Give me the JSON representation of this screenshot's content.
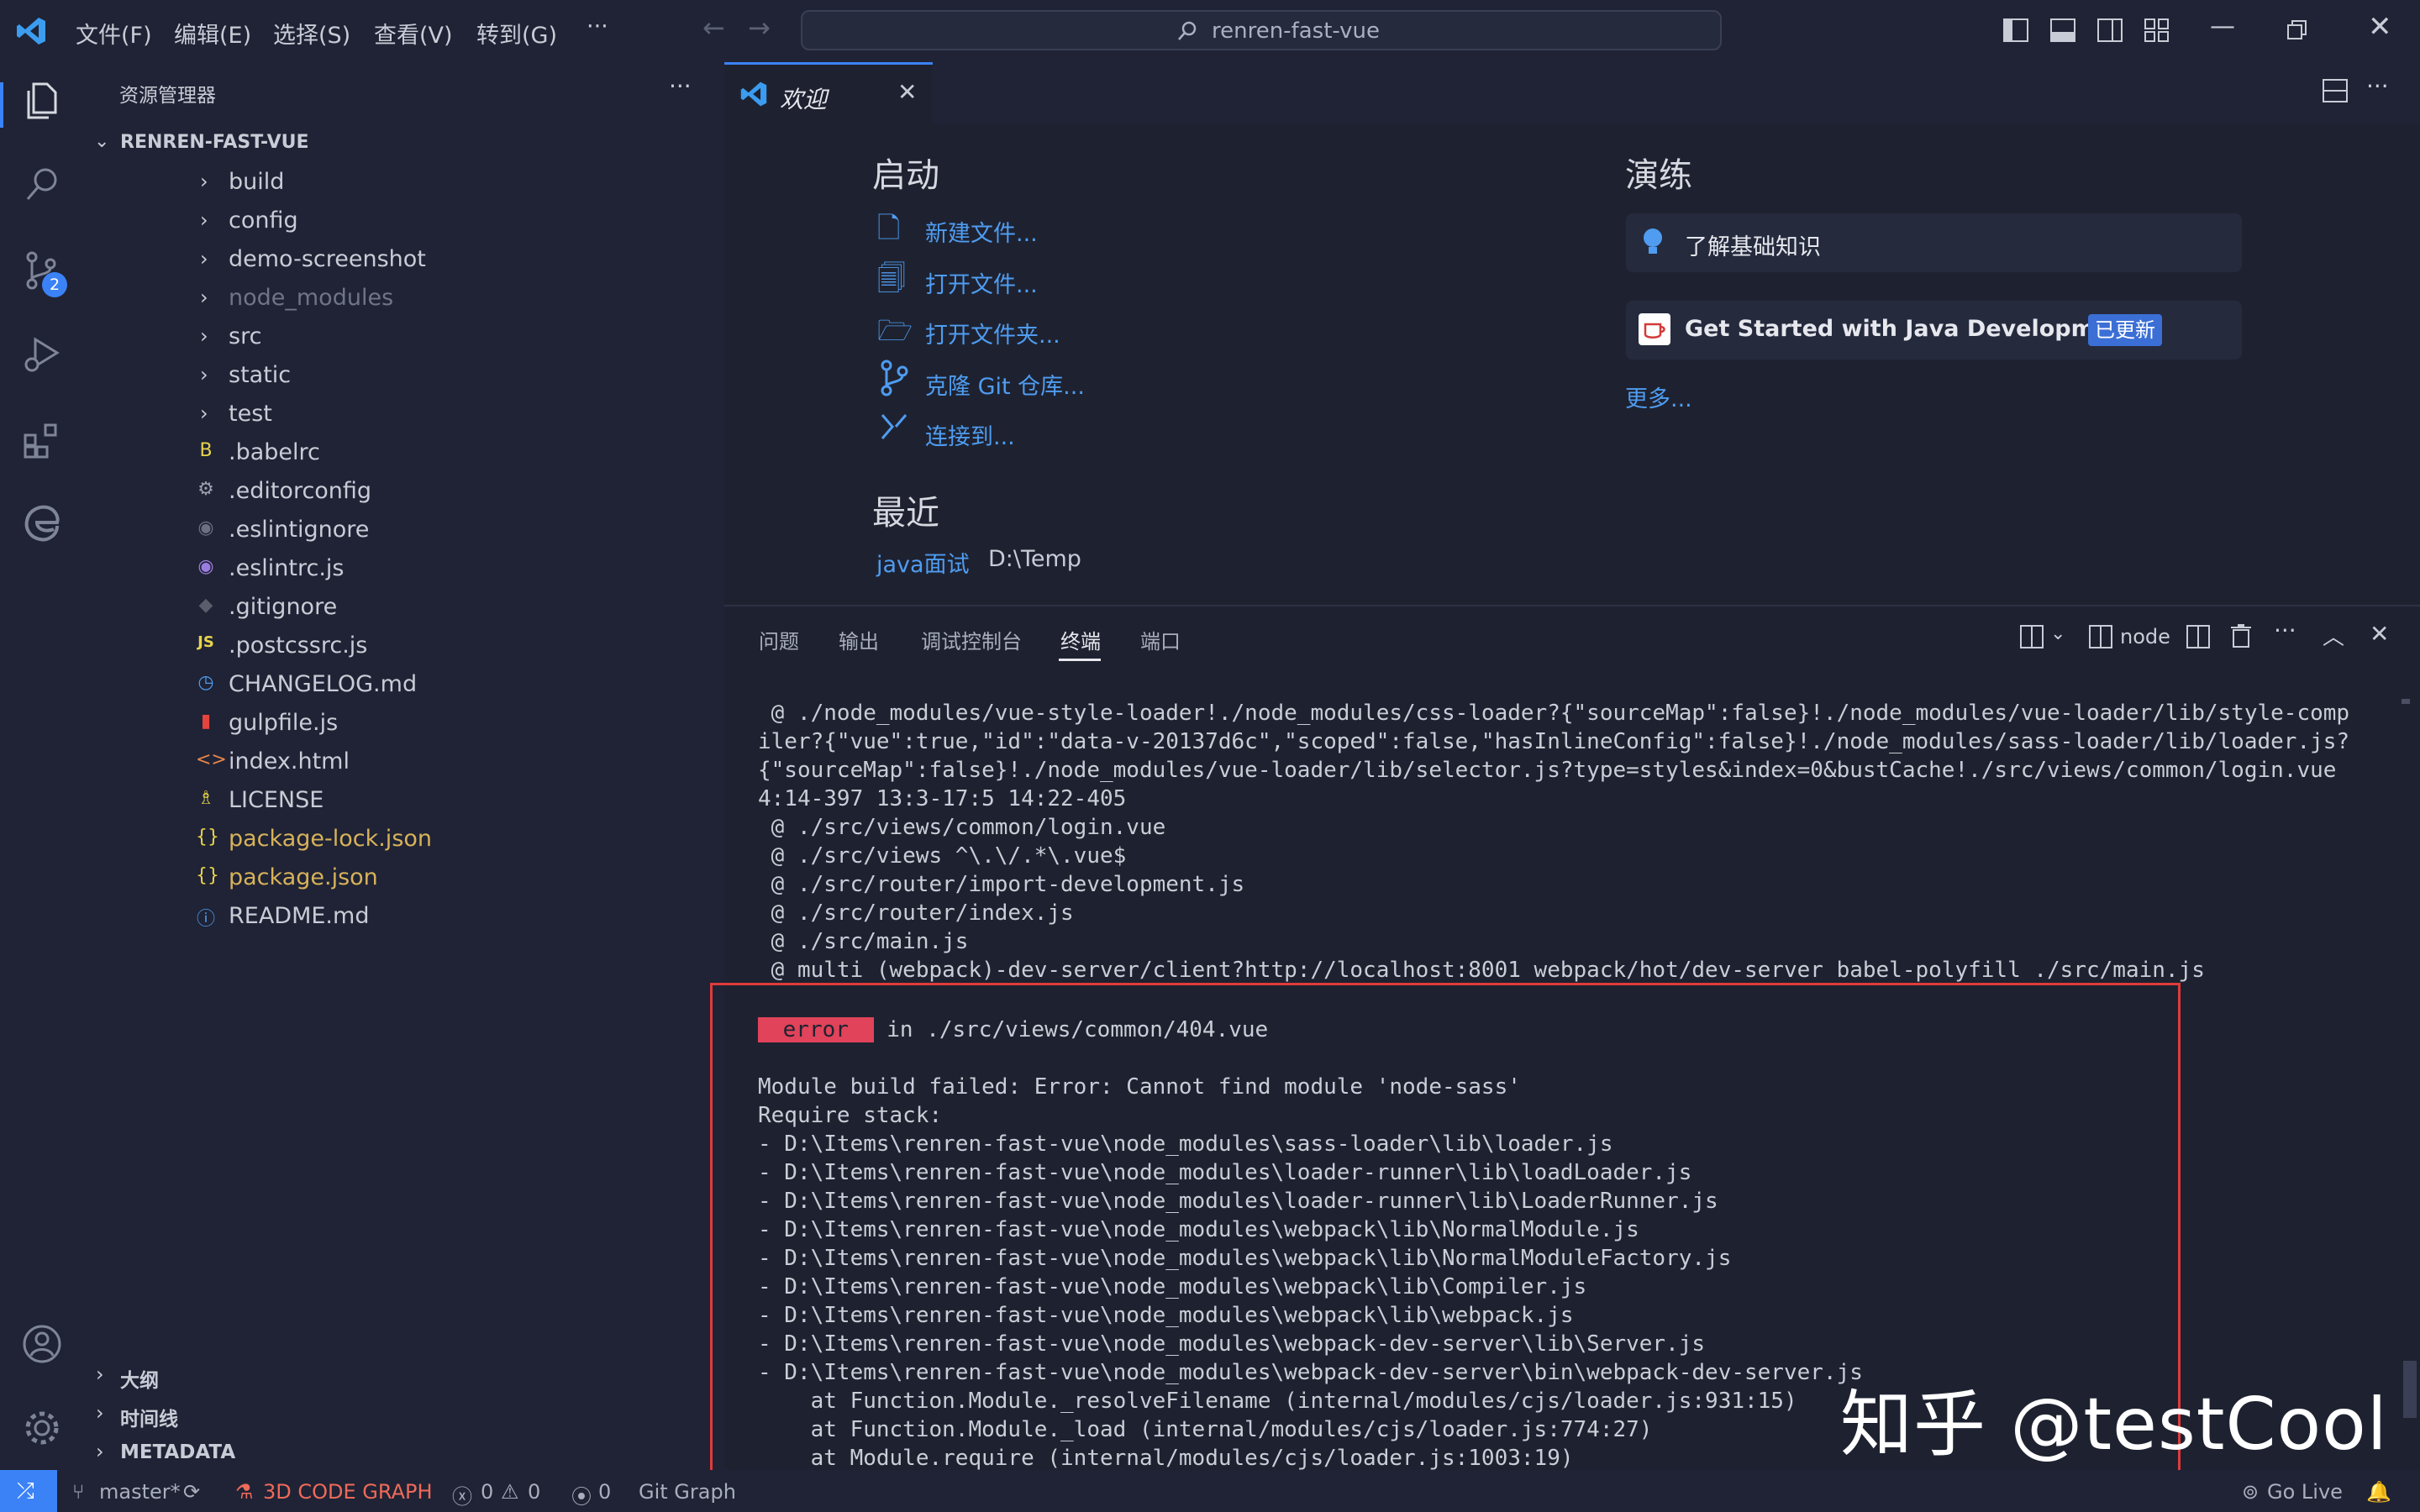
{
  "titlebar": {
    "menus": [
      "文件(F)",
      "编辑(E)",
      "选择(S)",
      "查看(V)",
      "转到(G)",
      "···"
    ],
    "search_text": "renren-fast-vue"
  },
  "activity": {
    "scm_badge": "2"
  },
  "sidebar": {
    "title": "资源管理器",
    "more": "···",
    "root": "RENREN-FAST-VUE",
    "items": [
      {
        "label": "build",
        "type": "folder"
      },
      {
        "label": "config",
        "type": "folder"
      },
      {
        "label": "demo-screenshot",
        "type": "folder"
      },
      {
        "label": "node_modules",
        "type": "folder"
      },
      {
        "label": "src",
        "type": "folder"
      },
      {
        "label": "static",
        "type": "folder"
      },
      {
        "label": "test",
        "type": "folder"
      },
      {
        "label": ".babelrc",
        "type": "file",
        "icon": "B"
      },
      {
        "label": ".editorconfig",
        "type": "file",
        "icon": "⚙"
      },
      {
        "label": ".eslintignore",
        "type": "file",
        "icon": "◉"
      },
      {
        "label": ".eslintrc.js",
        "type": "file",
        "icon": "◉"
      },
      {
        "label": ".gitignore",
        "type": "file",
        "icon": "◆"
      },
      {
        "label": ".postcssrc.js",
        "type": "file",
        "icon": "JS"
      },
      {
        "label": "CHANGELOG.md",
        "type": "file",
        "icon": "◷"
      },
      {
        "label": "gulpfile.js",
        "type": "file",
        "icon": "▮"
      },
      {
        "label": "index.html",
        "type": "file",
        "icon": "<>"
      },
      {
        "label": "LICENSE",
        "type": "file",
        "icon": "♗"
      },
      {
        "label": "package-lock.json",
        "type": "file",
        "icon": "{}",
        "mark": "M"
      },
      {
        "label": "package.json",
        "type": "file",
        "icon": "{}",
        "mark": "M"
      },
      {
        "label": "README.md",
        "type": "file",
        "icon": "ⓘ"
      }
    ],
    "sections": [
      "大纲",
      "时间线",
      "METADATA"
    ]
  },
  "editor": {
    "tab_label": "欢迎",
    "start_heading": "启动",
    "start_items": [
      "新建文件...",
      "打开文件...",
      "打开文件夹...",
      "克隆 Git 仓库...",
      "连接到..."
    ],
    "recent_heading": "最近",
    "recent_name": "java面试",
    "recent_path": "D:\\Temp",
    "walk_heading": "演练",
    "walk_items": [
      {
        "label": "了解基础知识"
      },
      {
        "label": "Get Started with Java Development",
        "badge": "已更新"
      }
    ],
    "more_link": "更多..."
  },
  "panel": {
    "tabs": [
      "问题",
      "输出",
      "调试控制台",
      "终端",
      "端口"
    ],
    "active_tab": "终端",
    "terminal_name": "node",
    "lines": [
      " @ ./node_modules/vue-style-loader!./node_modules/css-loader?{\"sourceMap\":false}!./node_modules/vue-loader/lib/style-comp",
      "iler?{\"vue\":true,\"id\":\"data-v-20137d6c\",\"scoped\":false,\"hasInlineConfig\":false}!./node_modules/sass-loader/lib/loader.js?",
      "{\"sourceMap\":false}!./node_modules/vue-loader/lib/selector.js?type=styles&index=0&bustCache!./src/views/common/login.vue",
      "4:14-397 13:3-17:5 14:22-405",
      " @ ./src/views/common/login.vue",
      " @ ./src/views ^\\.\\/.*\\.vue$",
      " @ ./src/router/import-development.js",
      " @ ./src/router/index.js",
      " @ ./src/main.js",
      " @ multi (webpack)-dev-server/client?http://localhost:8001 webpack/hot/dev-server babel-polyfill ./src/main.js"
    ],
    "error_badge": " error ",
    "error_in": " in ./src/views/common/404.vue",
    "error_lines": [
      "Module build failed: Error: Cannot find module 'node-sass'",
      "Require stack:",
      "- D:\\Items\\renren-fast-vue\\node_modules\\sass-loader\\lib\\loader.js",
      "- D:\\Items\\renren-fast-vue\\node_modules\\loader-runner\\lib\\loadLoader.js",
      "- D:\\Items\\renren-fast-vue\\node_modules\\loader-runner\\lib\\LoaderRunner.js",
      "- D:\\Items\\renren-fast-vue\\node_modules\\webpack\\lib\\NormalModule.js",
      "- D:\\Items\\renren-fast-vue\\node_modules\\webpack\\lib\\NormalModuleFactory.js",
      "- D:\\Items\\renren-fast-vue\\node_modules\\webpack\\lib\\Compiler.js",
      "- D:\\Items\\renren-fast-vue\\node_modules\\webpack\\lib\\webpack.js",
      "- D:\\Items\\renren-fast-vue\\node_modules\\webpack-dev-server\\lib\\Server.js",
      "- D:\\Items\\renren-fast-vue\\node_modules\\webpack-dev-server\\bin\\webpack-dev-server.js",
      "    at Function.Module._resolveFilename (internal/modules/cjs/loader.js:931:15)",
      "    at Function.Module._load (internal/modules/cjs/loader.js:774:27)",
      "    at Module.require (internal/modules/cjs/loader.js:1003:19)"
    ]
  },
  "statusbar": {
    "branch": "master*",
    "code_graph": "3D CODE GRAPH",
    "errors": "0",
    "warnings": "0",
    "ports": "0",
    "git_graph": "Git Graph",
    "go_live": "Go Live"
  },
  "watermark": "知乎 @testCool",
  "colors": {
    "accent": "#3b82f6",
    "link": "#4f9cf1",
    "error_badge": "#e0435a",
    "highlight_box": "#e03b3b",
    "modified": "#d8b25a"
  }
}
